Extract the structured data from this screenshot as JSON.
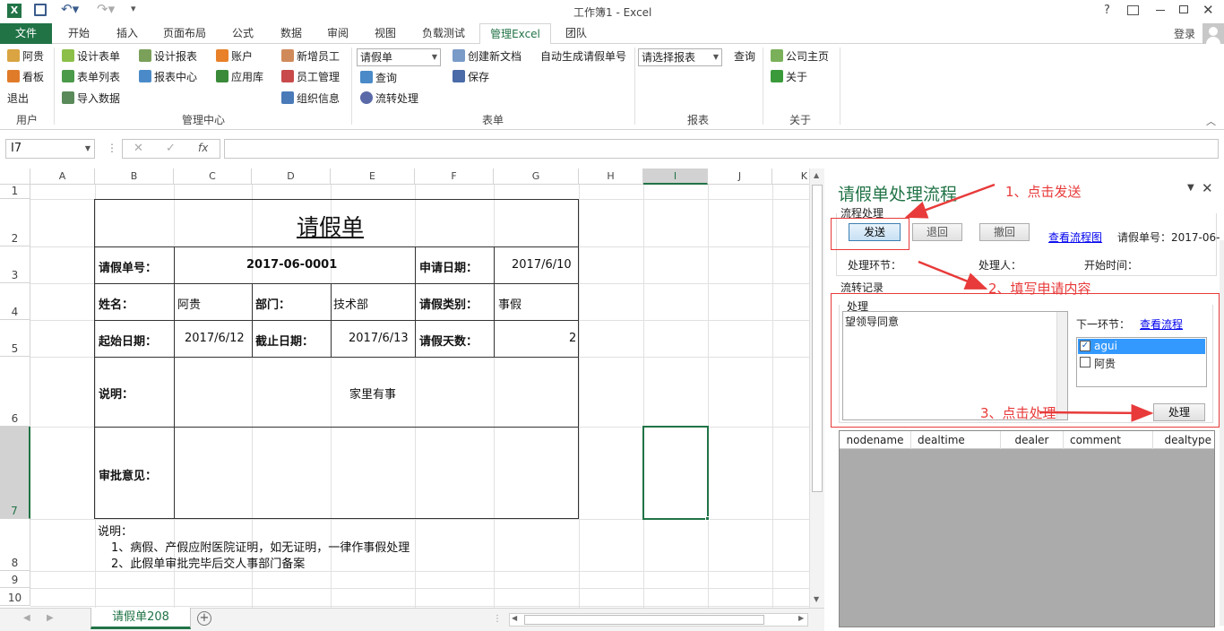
{
  "window": {
    "title": "工作簿1 - Excel",
    "help": "?",
    "login": "登录"
  },
  "tabs": [
    "文件",
    "开始",
    "插入",
    "页面布局",
    "公式",
    "数据",
    "审阅",
    "视图",
    "负载测试",
    "管理Excel",
    "团队"
  ],
  "ribbon": {
    "user": {
      "items": [
        "阿贵",
        "看板",
        "退出"
      ],
      "group": "用户"
    },
    "mgmt": {
      "items": [
        "设计表单",
        "表单列表",
        "导入数据",
        "设计报表",
        "报表中心",
        "账户",
        "应用库",
        "新增员工",
        "员工管理",
        "组织信息"
      ],
      "group": "管理中心"
    },
    "form": {
      "select": "请假单",
      "query": "查询",
      "flow": "流转处理",
      "create": "创建新文档",
      "save": "保存",
      "auto": "自动生成请假单号",
      "group": "表单"
    },
    "report": {
      "select": "请选择报表",
      "query": "查询",
      "group": "报表"
    },
    "about": {
      "home": "公司主页",
      "about": "关于",
      "group": "关于"
    }
  },
  "formula": {
    "namebox": "I7",
    "fx": "fx",
    "content": ""
  },
  "columns": [
    "A",
    "B",
    "C",
    "D",
    "E",
    "F",
    "G",
    "H",
    "I",
    "J",
    "K"
  ],
  "rows": [
    "1",
    "2",
    "3",
    "4",
    "5",
    "6",
    "7",
    "8",
    "9",
    "10"
  ],
  "form": {
    "title": "请假单",
    "no_label": "请假单号：",
    "no_value": "2017-06-0001",
    "apply_label": "申请日期：",
    "apply_value": "2017/6/10",
    "name_label": "姓名：",
    "name_value": "阿贵",
    "dept_label": "部门：",
    "dept_value": "技术部",
    "type_label": "请假类别：",
    "type_value": "事假",
    "start_label": "起始日期：",
    "start_value": "2017/6/12",
    "end_label": "截止日期：",
    "end_value": "2017/6/13",
    "days_label": "请假天数：",
    "days_value": "2",
    "desc_label": "说明：",
    "desc_value": "家里有事",
    "approve_label": "审批意见：",
    "note_title": "说明：",
    "note1": "1、病假、产假应附医院证明，如无证明，一律作事假处理",
    "note2": "2、此假单审批完毕后交人事部门备案"
  },
  "sheet_tab": "请假单208",
  "pane": {
    "title": "请假单处理流程",
    "flow_section": "流程处理",
    "send": "发送",
    "back": "退回",
    "undo": "撤回",
    "view_chart": "查看流程图",
    "no_label": "请假单号：2017-06-",
    "node_label": "处理环节：",
    "person_label": "处理人：",
    "time_label": "开始时间：",
    "record_section": "流转记录",
    "handle_section": "处理",
    "comment": "望领导同意",
    "next_label": "下一环节：",
    "view_flow": "查看流程",
    "users": [
      {
        "name": "agui",
        "checked": true
      },
      {
        "name": "阿贵",
        "checked": false
      }
    ],
    "process": "处理",
    "grid_headers": [
      "nodename",
      "dealtime",
      "dealer",
      "comment",
      "dealtype"
    ]
  },
  "annotations": [
    "1、点击发送",
    "2、填写申请内容",
    "3、点击处理"
  ],
  "colors": {
    "excel_green": "#217346",
    "annotation_red": "#e83a3a",
    "pane_title": "#217346"
  }
}
